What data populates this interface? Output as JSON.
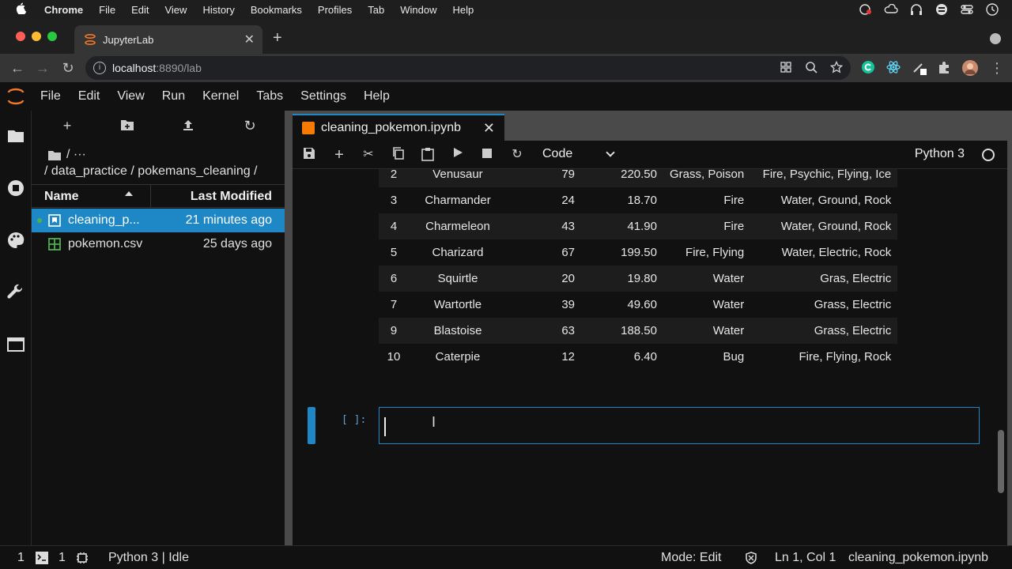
{
  "mac_menu": {
    "app": "Chrome",
    "items": [
      "File",
      "Edit",
      "View",
      "History",
      "Bookmarks",
      "Profiles",
      "Tab",
      "Window",
      "Help"
    ]
  },
  "browser": {
    "tab_title": "JupyterLab",
    "url_host": "localhost",
    "url_path": ":8890/lab"
  },
  "jupyter_menu": [
    "File",
    "Edit",
    "View",
    "Run",
    "Kernel",
    "Tabs",
    "Settings",
    "Help"
  ],
  "file_browser": {
    "breadcrumb_top": "/ ···",
    "breadcrumb": "/ data_practice / pokemans_cleaning /",
    "header_name": "Name",
    "header_modified": "Last Modified",
    "files": [
      {
        "name": "cleaning_p...",
        "modified": "21 minutes ago",
        "selected": true,
        "running": true,
        "kind": "notebook"
      },
      {
        "name": "pokemon.csv",
        "modified": "25 days ago",
        "selected": false,
        "running": false,
        "kind": "csv"
      }
    ]
  },
  "notebook": {
    "tab_title": "cleaning_pokemon.ipynb",
    "cell_type": "Code",
    "kernel": "Python 3",
    "prompt": "[ ]:",
    "table_rows": [
      [
        "2",
        "Venusaur",
        "79",
        "220.50",
        "Grass, Poison",
        "Fire, Psychic, Flying, Ice"
      ],
      [
        "3",
        "Charmander",
        "24",
        "18.70",
        "Fire",
        "Water, Ground, Rock"
      ],
      [
        "4",
        "Charmeleon",
        "43",
        "41.90",
        "Fire",
        "Water, Ground, Rock"
      ],
      [
        "5",
        "Charizard",
        "67",
        "199.50",
        "Fire, Flying",
        "Water, Electric, Rock"
      ],
      [
        "6",
        "Squirtle",
        "20",
        "19.80",
        "Water",
        "Gras, Electric"
      ],
      [
        "7",
        "Wartortle",
        "39",
        "49.60",
        "Water",
        "Grass, Electric"
      ],
      [
        "9",
        "Blastoise",
        "63",
        "188.50",
        "Water",
        "Grass, Electric"
      ],
      [
        "10",
        "Caterpie",
        "12",
        "6.40",
        "Bug",
        "Fire, Flying, Rock"
      ]
    ]
  },
  "status": {
    "count1": "1",
    "count2": "1",
    "kernel_status": "Python 3 | Idle",
    "mode": "Mode: Edit",
    "position": "Ln 1, Col 1",
    "filename": "cleaning_pokemon.ipynb"
  },
  "colors": {
    "accent": "#1e88c7",
    "running_dot": "#4caf50",
    "notebook_icon": "#f57c00"
  }
}
